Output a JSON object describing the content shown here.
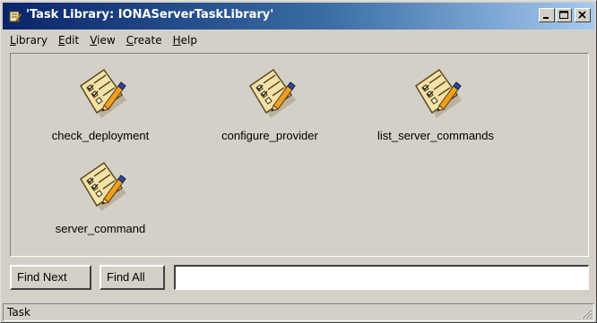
{
  "window": {
    "title": "'Task Library: IONAServerTaskLibrary'",
    "app_icon": "task-library-app-icon",
    "controls": [
      "minimize-icon",
      "maximize-icon",
      "close-icon"
    ]
  },
  "menu": {
    "items": [
      {
        "label": "Library",
        "mnemonic": "L"
      },
      {
        "label": "Edit",
        "mnemonic": "E"
      },
      {
        "label": "View",
        "mnemonic": "V"
      },
      {
        "label": "Create",
        "mnemonic": "C"
      },
      {
        "label": "Help",
        "mnemonic": "H"
      }
    ]
  },
  "tasks": [
    {
      "label": "check_deployment",
      "icon": "task-checklist-icon"
    },
    {
      "label": "configure_provider",
      "icon": "task-checklist-icon"
    },
    {
      "label": "list_server_commands",
      "icon": "task-checklist-icon"
    },
    {
      "label": "server_command",
      "icon": "task-checklist-icon"
    }
  ],
  "find": {
    "find_next_label": "Find Next",
    "find_all_label": "Find All",
    "search_value": ""
  },
  "status": {
    "text": "Task"
  },
  "colors": {
    "face": "#d4d0c8",
    "title_start": "#0a246a",
    "title_end": "#a6caf0"
  }
}
